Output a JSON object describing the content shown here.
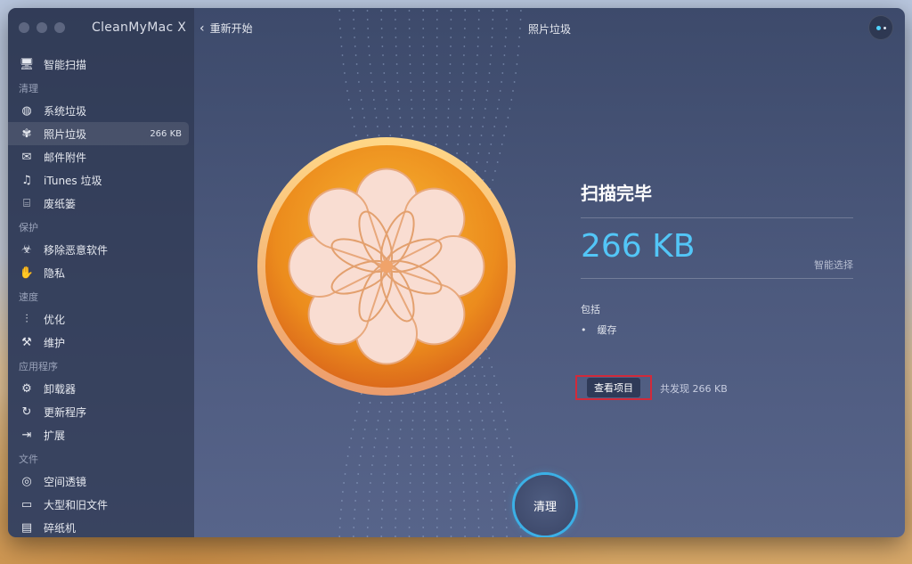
{
  "app": {
    "title": "CleanMyMac X"
  },
  "topbar": {
    "back_label": "重新开始",
    "page_title": "照片垃圾"
  },
  "sidebar": {
    "top_item": {
      "label": "智能扫描",
      "icon": "smart-scan-icon"
    },
    "sections": [
      {
        "heading": "清理",
        "items": [
          {
            "label": "系统垃圾",
            "icon": "system-junk-icon"
          },
          {
            "label": "照片垃圾",
            "icon": "photo-junk-icon",
            "size": "266 KB",
            "active": true
          },
          {
            "label": "邮件附件",
            "icon": "mail-icon"
          },
          {
            "label": "iTunes 垃圾",
            "icon": "music-note-icon"
          },
          {
            "label": "废纸篓",
            "icon": "trash-icon"
          }
        ]
      },
      {
        "heading": "保护",
        "items": [
          {
            "label": "移除恶意软件",
            "icon": "biohazard-icon"
          },
          {
            "label": "隐私",
            "icon": "hand-icon"
          }
        ]
      },
      {
        "heading": "速度",
        "items": [
          {
            "label": "优化",
            "icon": "sliders-icon"
          },
          {
            "label": "维护",
            "icon": "wrench-icon"
          }
        ]
      },
      {
        "heading": "应用程序",
        "items": [
          {
            "label": "卸载器",
            "icon": "uninstaller-icon"
          },
          {
            "label": "更新程序",
            "icon": "updater-icon"
          },
          {
            "label": "扩展",
            "icon": "extensions-icon"
          }
        ]
      },
      {
        "heading": "文件",
        "items": [
          {
            "label": "空间透镜",
            "icon": "space-lens-icon"
          },
          {
            "label": "大型和旧文件",
            "icon": "folder-icon"
          },
          {
            "label": "碎纸机",
            "icon": "shredder-icon"
          }
        ]
      }
    ]
  },
  "result": {
    "title": "扫描完毕",
    "size": "266 KB",
    "smart_select": "智能选择",
    "includes_label": "包括",
    "includes": [
      "缓存"
    ],
    "view_items_label": "查看项目",
    "found_text": "共发现 266 KB"
  },
  "clean_button": {
    "label": "清理"
  },
  "colors": {
    "accent": "#53c6f7",
    "highlight_border": "#d22a3a",
    "orange": "#f0a027"
  }
}
